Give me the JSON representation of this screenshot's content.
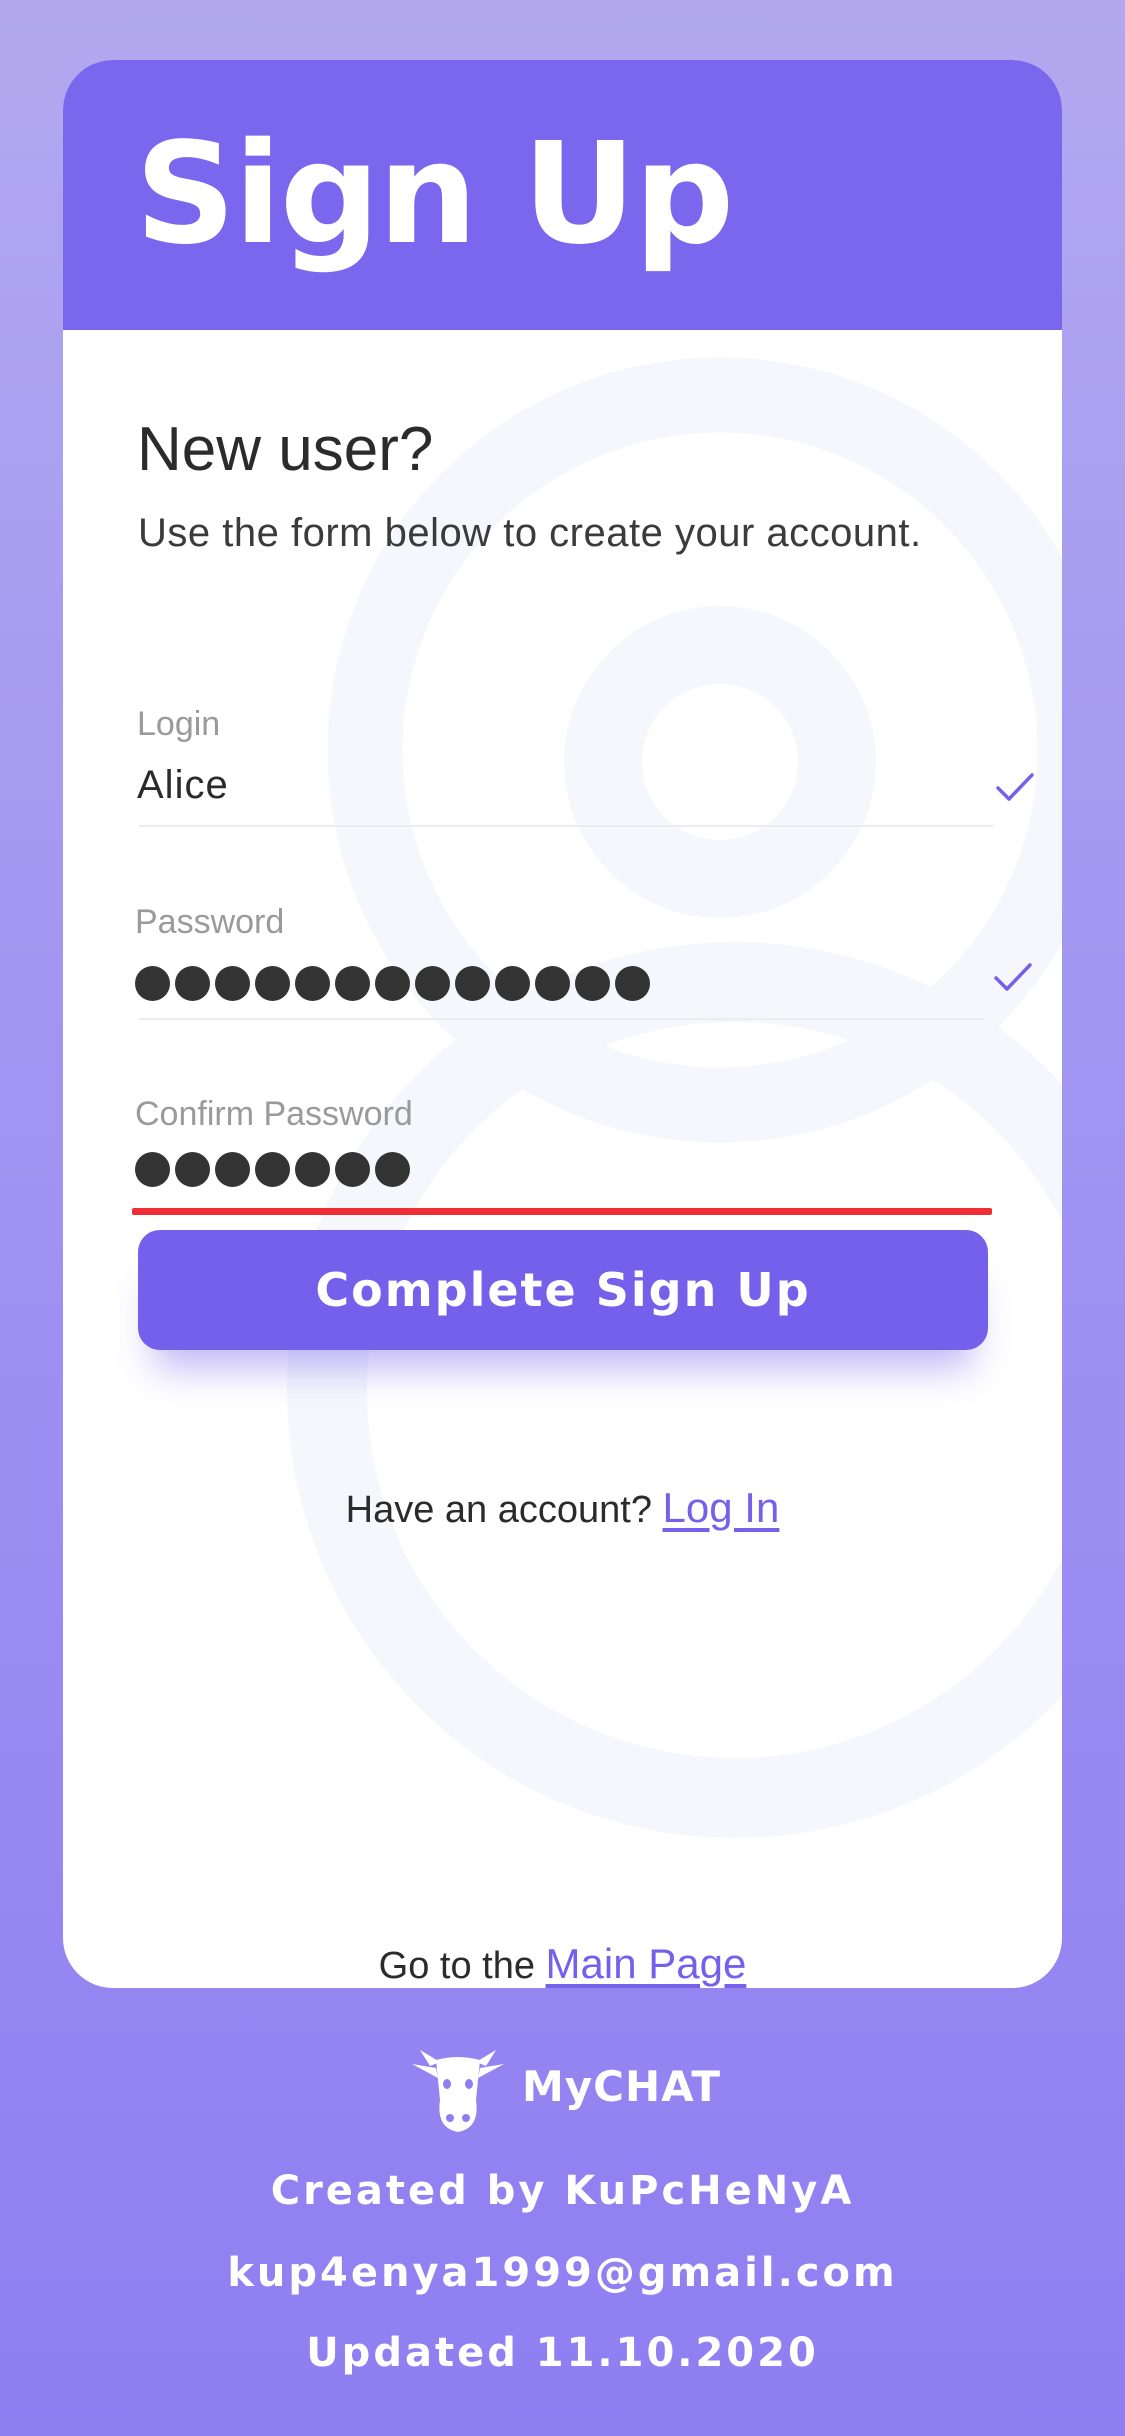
{
  "card": {
    "title": "Sign Up",
    "heading": "New user?",
    "subheading": "Use the form below to create your account."
  },
  "form": {
    "login": {
      "label": "Login",
      "value": "Alice",
      "valid": true
    },
    "password": {
      "label": "Password",
      "masked_length": 13,
      "valid": true
    },
    "confirm_password": {
      "label": "Confirm Password",
      "masked_length": 7,
      "error": true
    },
    "submit_label": "Complete Sign Up"
  },
  "login_prompt": {
    "text": "Have an account?",
    "link": "Log In"
  },
  "main_page_prompt": {
    "text": "Go to the",
    "link": "Main Page"
  },
  "footer": {
    "brand": "MyCHAT",
    "created_by": "Created by KuPcHeNyA",
    "email": "kup4enya1999@gmail.com",
    "updated": "Updated 11.10.2020"
  },
  "colors": {
    "accent": "#7560ec",
    "header": "#7b66ee",
    "error": "#ee2d35",
    "background_top": "#b3a8ef",
    "background_bottom": "#8f7ef1"
  },
  "icons": {
    "valid": "check-icon",
    "logo": "cow-logo-icon"
  }
}
